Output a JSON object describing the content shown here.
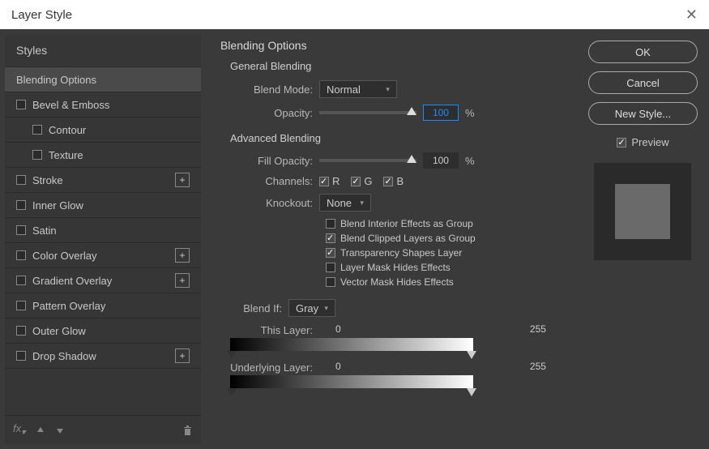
{
  "title": "Layer Style",
  "sidebar": {
    "header": "Styles",
    "items": [
      {
        "label": "Blending Options",
        "selected": true,
        "hasCheckbox": false
      },
      {
        "label": "Bevel & Emboss",
        "hasCheckbox": true
      },
      {
        "label": "Contour",
        "hasCheckbox": true,
        "sub": true
      },
      {
        "label": "Texture",
        "hasCheckbox": true,
        "sub": true
      },
      {
        "label": "Stroke",
        "hasCheckbox": true,
        "hasPlus": true
      },
      {
        "label": "Inner Glow",
        "hasCheckbox": true
      },
      {
        "label": "Satin",
        "hasCheckbox": true
      },
      {
        "label": "Color Overlay",
        "hasCheckbox": true,
        "hasPlus": true
      },
      {
        "label": "Gradient Overlay",
        "hasCheckbox": true,
        "hasPlus": true
      },
      {
        "label": "Pattern Overlay",
        "hasCheckbox": true
      },
      {
        "label": "Outer Glow",
        "hasCheckbox": true
      },
      {
        "label": "Drop Shadow",
        "hasCheckbox": true,
        "hasPlus": true
      }
    ],
    "fx_label": "fx"
  },
  "main": {
    "title": "Blending Options",
    "general": {
      "title": "General Blending",
      "blend_mode_label": "Blend Mode:",
      "blend_mode_value": "Normal",
      "opacity_label": "Opacity:",
      "opacity_value": "100",
      "pct": "%"
    },
    "advanced": {
      "title": "Advanced Blending",
      "fill_label": "Fill Opacity:",
      "fill_value": "100",
      "channels_label": "Channels:",
      "ch_r": "R",
      "ch_g": "G",
      "ch_b": "B",
      "knockout_label": "Knockout:",
      "knockout_value": "None",
      "opt1": "Blend Interior Effects as Group",
      "opt2": "Blend Clipped Layers as Group",
      "opt3": "Transparency Shapes Layer",
      "opt4": "Layer Mask Hides Effects",
      "opt5": "Vector Mask Hides Effects"
    },
    "blendif": {
      "label": "Blend If:",
      "value": "Gray",
      "this_label": "This Layer:",
      "this_lo": "0",
      "this_hi": "255",
      "under_label": "Underlying Layer:",
      "under_lo": "0",
      "under_hi": "255"
    }
  },
  "right": {
    "ok": "OK",
    "cancel": "Cancel",
    "new_style": "New Style...",
    "preview": "Preview"
  }
}
